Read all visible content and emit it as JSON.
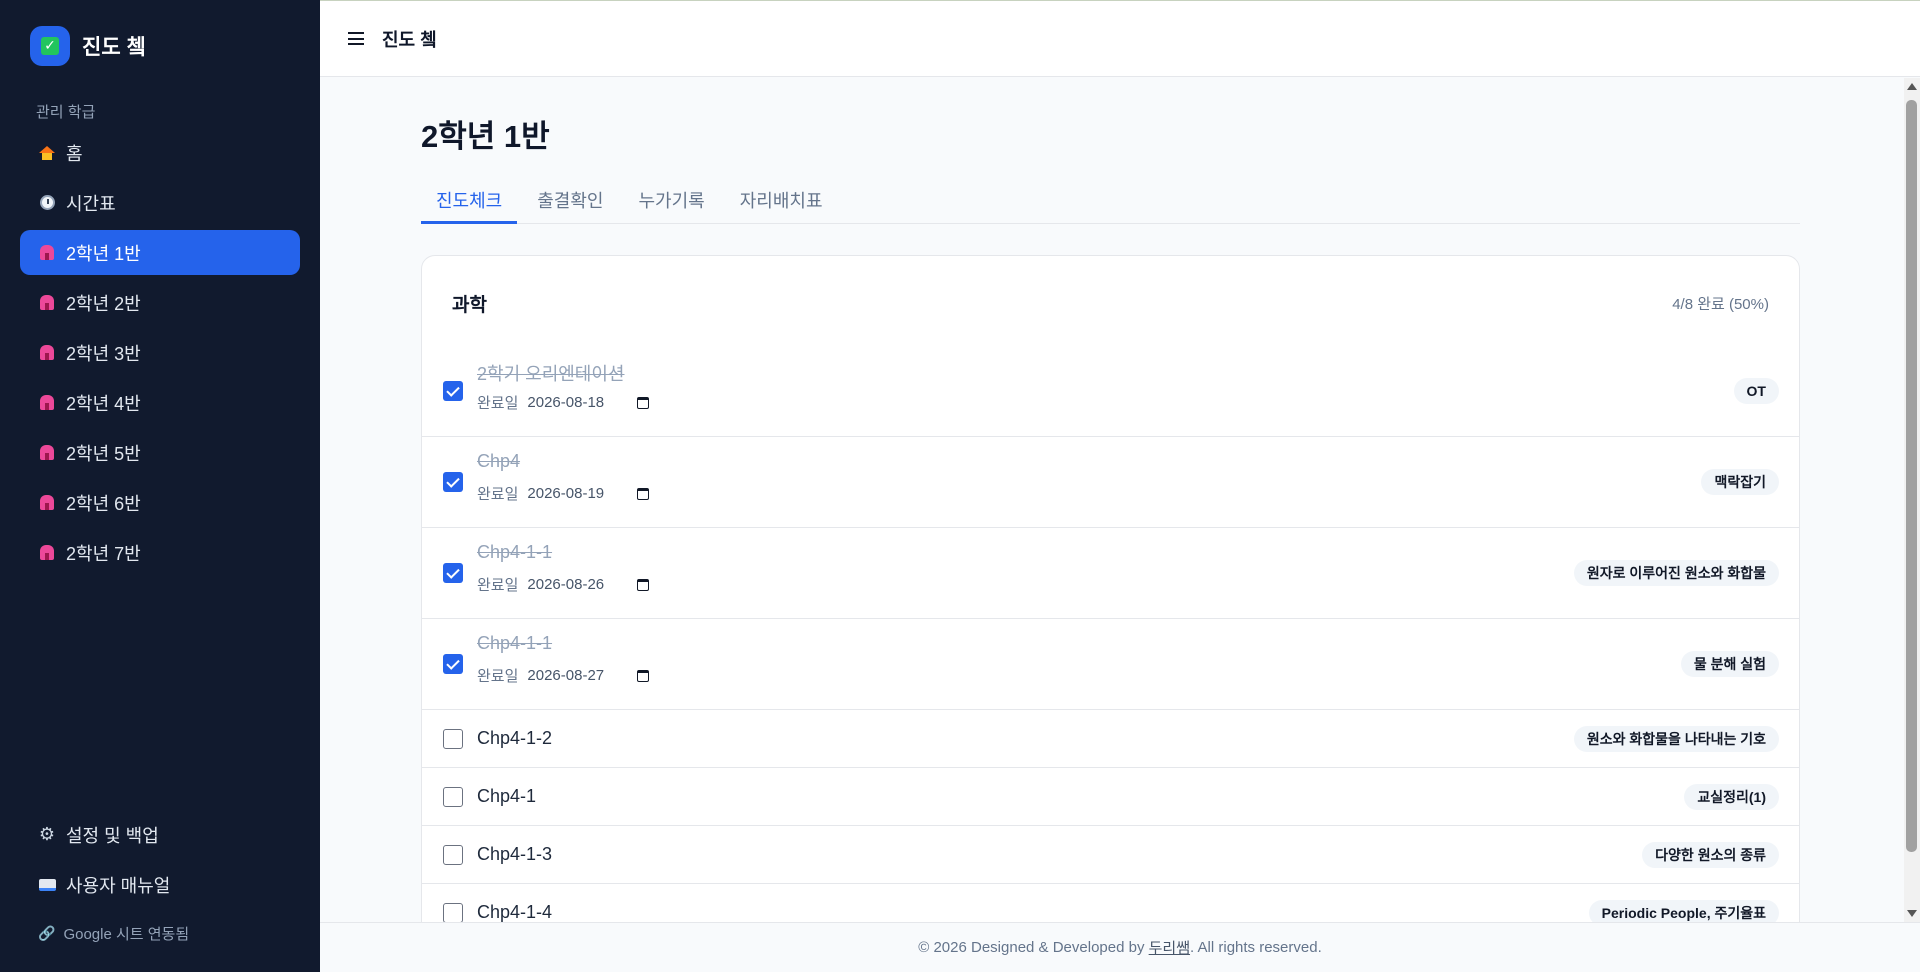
{
  "app": {
    "name": "진도 쳌",
    "top_title": "진도 쳌"
  },
  "sidebar": {
    "section_label": "관리 학급",
    "items": [
      {
        "label": "홈",
        "icon": "home-icon"
      },
      {
        "label": "시간표",
        "icon": "clock-icon"
      },
      {
        "label": "2학년 1반",
        "icon": "school-icon",
        "active": true
      },
      {
        "label": "2학년 2반",
        "icon": "school-icon"
      },
      {
        "label": "2학년 3반",
        "icon": "school-icon"
      },
      {
        "label": "2학년 4반",
        "icon": "school-icon"
      },
      {
        "label": "2학년 5반",
        "icon": "school-icon"
      },
      {
        "label": "2학년 6반",
        "icon": "school-icon"
      },
      {
        "label": "2학년 7반",
        "icon": "school-icon"
      }
    ],
    "settings_label": "설정 및 백업",
    "manual_label": "사용자 매뉴얼",
    "sheet_status": "Google 시트 연동됨"
  },
  "main": {
    "page_title": "2학년 1반",
    "tabs": [
      {
        "label": "진도체크",
        "active": true
      },
      {
        "label": "출결확인"
      },
      {
        "label": "누가기록"
      },
      {
        "label": "자리배치표"
      }
    ],
    "card": {
      "subject": "과학",
      "progress": "4/8 완료 (50%)",
      "date_label": "완료일",
      "items": [
        {
          "title": "2학기 오리엔테이션",
          "done": true,
          "date": "2026-08-18",
          "tag": "OT"
        },
        {
          "title": "Chp4",
          "done": true,
          "date": "2026-08-19",
          "tag": "맥락잡기"
        },
        {
          "title": "Chp4-1-1",
          "done": true,
          "date": "2026-08-26",
          "tag": "원자로 이루어진 원소와 화합물"
        },
        {
          "title": "Chp4-1-1",
          "done": true,
          "date": "2026-08-27",
          "tag": "물 분해 실험"
        },
        {
          "title": "Chp4-1-2",
          "done": false,
          "tag": "원소와 화합물을 나타내는 기호"
        },
        {
          "title": "Chp4-1",
          "done": false,
          "tag": "교실정리(1)"
        },
        {
          "title": "Chp4-1-3",
          "done": false,
          "tag": "다양한 원소의 종류"
        },
        {
          "title": "Chp4-1-4",
          "done": false,
          "tag": "Periodic People, 주기율표"
        }
      ]
    }
  },
  "footer": {
    "prefix": "© 2026 Designed & Developed by ",
    "author": "두리쌤",
    "suffix": ". All rights reserved."
  },
  "colors": {
    "sidebar_bg": "#111a2e",
    "accent": "#2563eb"
  }
}
